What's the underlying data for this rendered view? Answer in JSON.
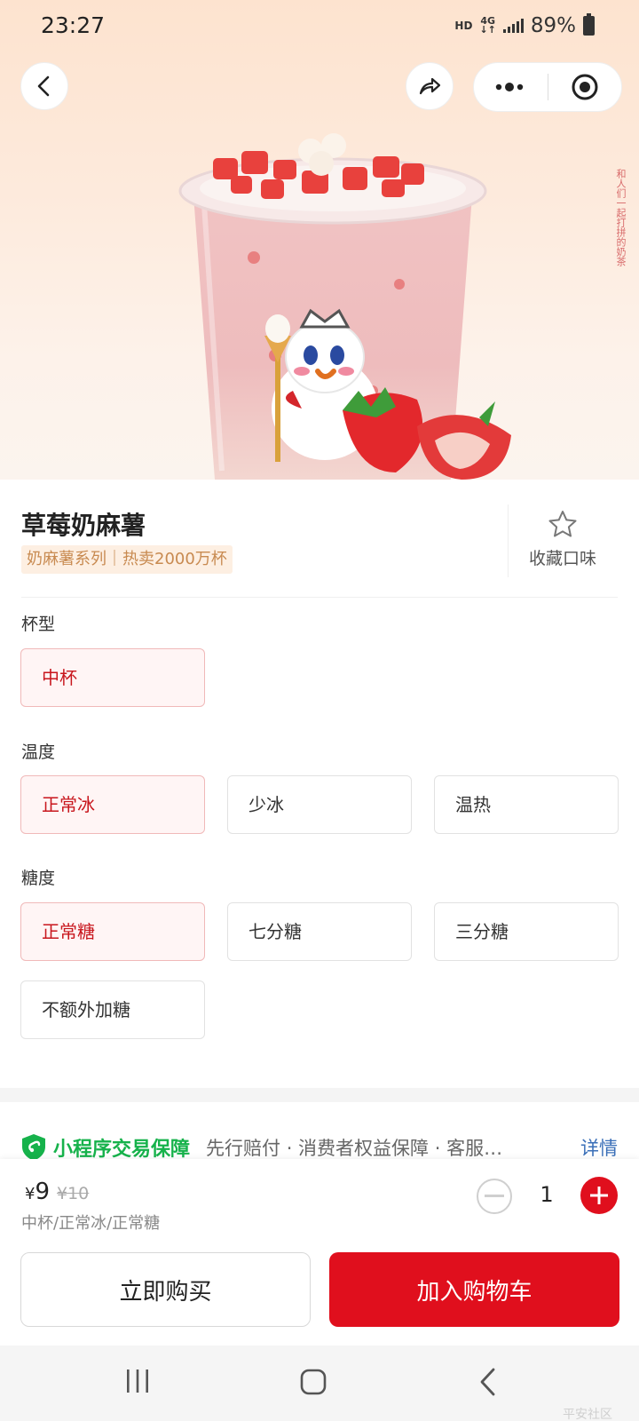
{
  "status_bar": {
    "time": "23:27",
    "hd": "HD",
    "network": "4G",
    "battery": "89%"
  },
  "nav": {
    "back_icon": "chevron-left-icon",
    "share_icon": "share-icon",
    "more_icon": "more-dots-icon",
    "close_icon": "target-icon"
  },
  "hero": {
    "side_text": "和人们一起打拼的奶茶"
  },
  "product": {
    "name": "草莓奶麻薯",
    "tag": "奶麻薯系列｜热卖2000万杯",
    "favorite_label": "收藏口味"
  },
  "options": {
    "cup": {
      "label": "杯型",
      "choices": [
        "中杯"
      ],
      "selected": "中杯"
    },
    "temperature": {
      "label": "温度",
      "choices": [
        "正常冰",
        "少冰",
        "温热"
      ],
      "selected": "正常冰"
    },
    "sugar": {
      "label": "糖度",
      "choices": [
        "正常糖",
        "七分糖",
        "三分糖",
        "不额外加糖"
      ],
      "selected": "正常糖"
    }
  },
  "guarantee": {
    "name": "小程序交易保障",
    "description": "先行赔付 · 消费者权益保障 · 客服…",
    "detail": "详情"
  },
  "cart": {
    "currency": "¥",
    "price": "9",
    "original_price": "¥10",
    "spec_summary": "中杯/正常冰/正常糖",
    "quantity": "1",
    "buy_now": "立即购买",
    "add_to_cart": "加入购物车"
  },
  "watermark": "平安社区",
  "colors": {
    "accent_red": "#e00f1d",
    "selected_text": "#c8161d",
    "guarantee_green": "#16b24b",
    "link_blue": "#3a6fb8",
    "tag_text": "#c88a50"
  }
}
